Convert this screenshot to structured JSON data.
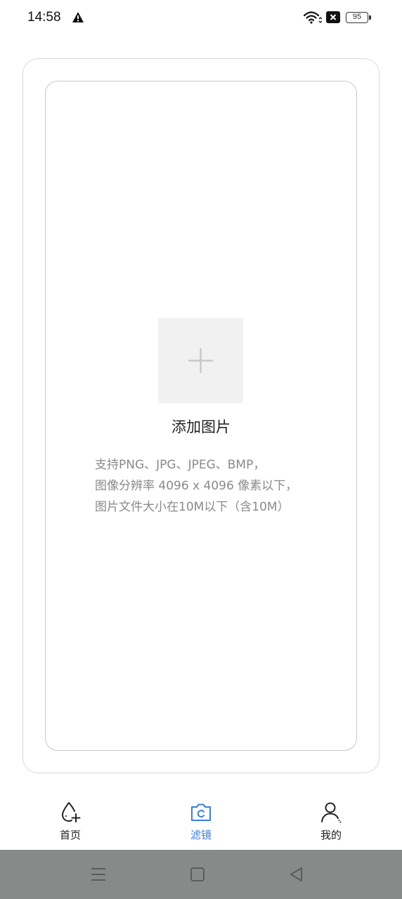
{
  "status_bar": {
    "time": "14:58",
    "warning_icon": "warning-triangle-icon",
    "wifi_icon": "wifi-icon",
    "sim_icon": "sim-no-service-icon",
    "battery_level": "95"
  },
  "upload": {
    "plus_icon": "plus-icon",
    "title": "添加图片",
    "hint_lines": [
      "支持PNG、JPG、JPEG、BMP，",
      "图像分辨率 4096 x 4096 像素以下，",
      "图片文件大小在10M以下（含10M）"
    ]
  },
  "bottom_nav": {
    "items": [
      {
        "label": "首页",
        "icon": "drop-add-icon",
        "active": false
      },
      {
        "label": "滤镜",
        "icon": "camera-filter-icon",
        "active": true
      },
      {
        "label": "我的",
        "icon": "user-icon",
        "active": false
      }
    ],
    "active_color": "#3b7ddd"
  },
  "system_nav": {
    "buttons": [
      "menu-icon",
      "home-icon",
      "back-icon"
    ]
  }
}
